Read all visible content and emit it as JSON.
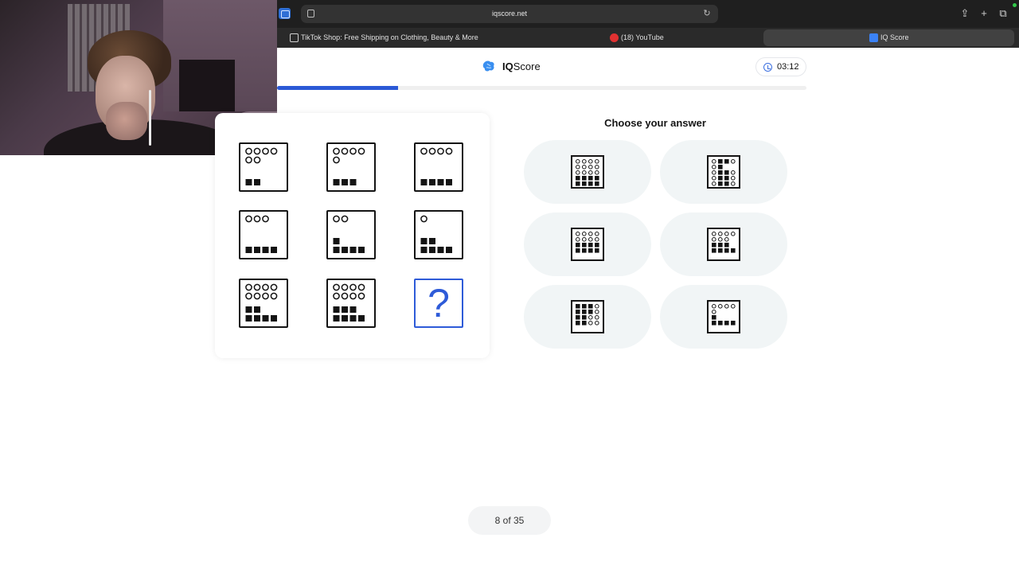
{
  "browser": {
    "url": "iqscore.net",
    "tabs": [
      {
        "label": "TikTok Shop: Free Shipping on Clothing, Beauty & More",
        "icon": "tiktok-icon",
        "active": false
      },
      {
        "label": "(18) YouTube",
        "icon": "youtube-icon",
        "active": false
      },
      {
        "label": "IQ Score",
        "icon": "iqscore-favicon",
        "active": true
      }
    ]
  },
  "header": {
    "logo_bold": "IQ",
    "logo_rest": "Score",
    "timer": "03:12"
  },
  "progress": {
    "value": 8,
    "total": 35
  },
  "colors": {
    "accent": "#2b59d6",
    "answer_bg": "#f1f5f6",
    "ink": "#141414"
  },
  "puzzle": {
    "cells": [
      {
        "row": 0,
        "col": 0,
        "circles": [
          4,
          2
        ],
        "squares": [
          2
        ]
      },
      {
        "row": 0,
        "col": 1,
        "circles": [
          4,
          1
        ],
        "squares": [
          3
        ]
      },
      {
        "row": 0,
        "col": 2,
        "circles": [
          4
        ],
        "squares": [
          4
        ]
      },
      {
        "row": 1,
        "col": 0,
        "circles": [
          3
        ],
        "squares": [
          4
        ]
      },
      {
        "row": 1,
        "col": 1,
        "circles": [
          2
        ],
        "squares": [
          1,
          4
        ]
      },
      {
        "row": 1,
        "col": 2,
        "circles": [
          1
        ],
        "squares": [
          2,
          4
        ]
      },
      {
        "row": 2,
        "col": 0,
        "circles": [
          4,
          4
        ],
        "squares": [
          2,
          4
        ]
      },
      {
        "row": 2,
        "col": 1,
        "circles": [
          4,
          4
        ],
        "squares": [
          3,
          4
        ]
      },
      {
        "row": 2,
        "col": 2,
        "question": "?"
      }
    ]
  },
  "answers": {
    "title": "Choose your answer",
    "options": [
      {
        "id": 1,
        "pattern": [
          "oooo",
          "oooo",
          "oooo",
          "####",
          "####"
        ]
      },
      {
        "id": 2,
        "pattern": [
          "o##o",
          "o#..",
          "o##o",
          "o##o",
          "o##o"
        ]
      },
      {
        "id": 3,
        "pattern": [
          "oooo",
          "oooo",
          "####",
          "####",
          "...."
        ]
      },
      {
        "id": 4,
        "pattern": [
          "oooo",
          "ooo.",
          "###.",
          "####",
          "...."
        ]
      },
      {
        "id": 5,
        "pattern": [
          "###o",
          "###o",
          "##oo",
          "##oo",
          "...."
        ]
      },
      {
        "id": 6,
        "pattern": [
          "oooo",
          "o...",
          "#...",
          "####",
          "...."
        ]
      }
    ]
  },
  "footer": {
    "page_label": "8 of 35"
  }
}
